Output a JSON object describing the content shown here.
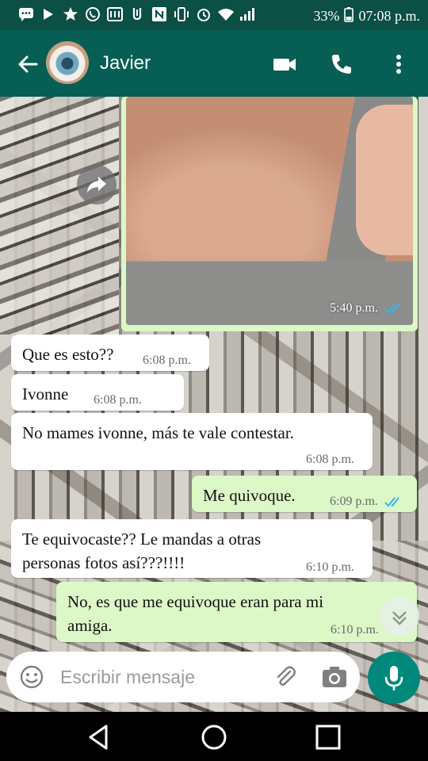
{
  "status_bar": {
    "icons": [
      "chat-icon",
      "play-icon",
      "star-icon",
      "whatsapp-icon",
      "news-icon",
      "usb-icon",
      "nfc-icon",
      "vibrate-icon",
      "alarm-icon",
      "wifi-icon",
      "signal-icon",
      "battery-icon"
    ],
    "battery": "33%",
    "time": "07:08 p.m."
  },
  "header": {
    "contact_name": "Javier",
    "icons": [
      "back-arrow-icon",
      "video-call-icon",
      "phone-icon",
      "more-vert-icon"
    ],
    "colors": {
      "header_bg": "#075e54",
      "status_bg": "#0b4f45"
    }
  },
  "messages": [
    {
      "type": "photo",
      "direction": "out",
      "time": "5:40 p.m.",
      "status": "read"
    },
    {
      "direction": "in",
      "text": "Que es esto??",
      "time": "6:08 p.m."
    },
    {
      "direction": "in",
      "text": "Ivonne",
      "time": "6:08 p.m."
    },
    {
      "direction": "in",
      "text": "No mames ivonne, más te vale contestar.",
      "time": "6:08 p.m."
    },
    {
      "direction": "out",
      "text": "Me quivoque.",
      "time": "6:09 p.m.",
      "status": "read"
    },
    {
      "direction": "in",
      "text_line1": "Te equivocaste?? Le mandas a otras",
      "text_line2": "personas fotos así???!!!!",
      "time": "6:10 p.m."
    },
    {
      "direction": "out",
      "text_line1": "No, es que me equivoque eran para mi",
      "text_line2": "amiga.",
      "time": "6:10 p.m."
    }
  ],
  "input": {
    "placeholder": "Escribir mensaje",
    "icons": [
      "emoji-icon",
      "attach-icon",
      "camera-icon",
      "mic-icon"
    ]
  },
  "navigation": {
    "icons": [
      "nav-back-icon",
      "nav-home-icon",
      "nav-recents-icon"
    ]
  },
  "colors": {
    "incoming_bubble": "#ffffff",
    "outgoing_bubble": "#dcf8c6",
    "read_ticks": "#34b7f1",
    "mic_button": "#00897b"
  }
}
